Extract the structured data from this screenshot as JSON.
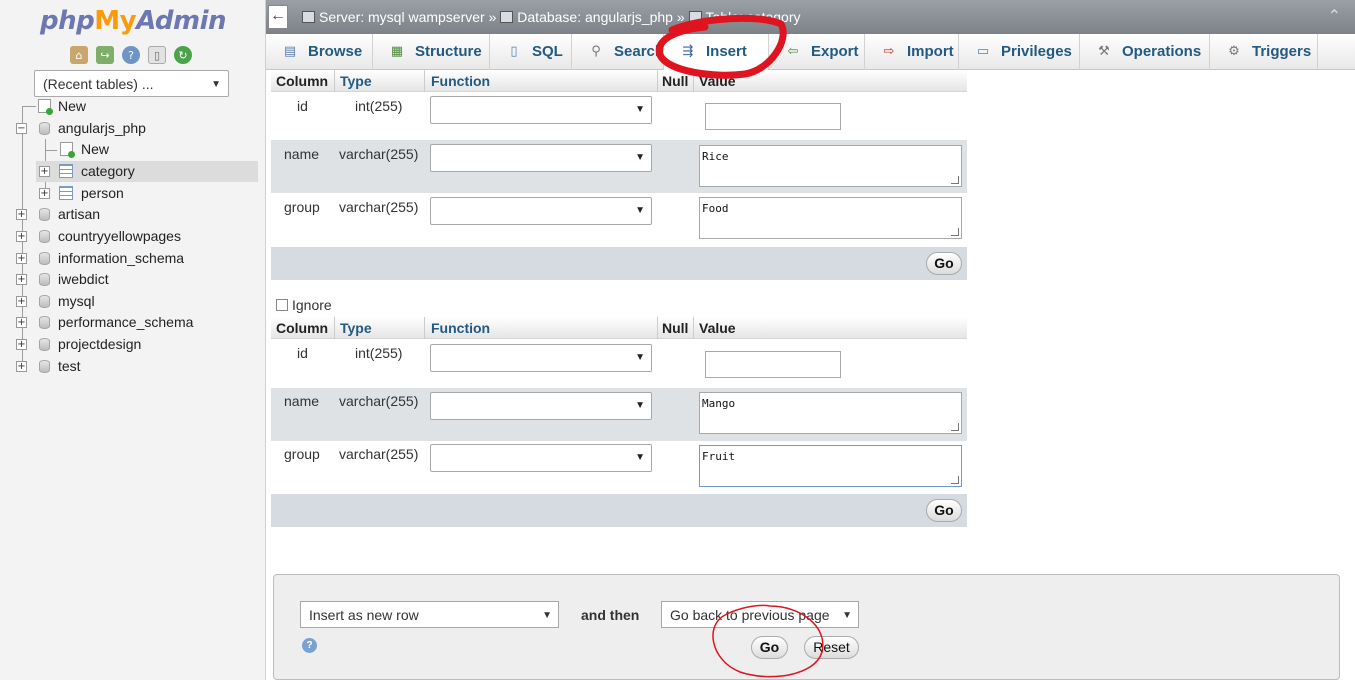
{
  "brand": {
    "php": "php",
    "my": "My",
    "admin": "Admin"
  },
  "nav": {
    "icons": [
      "home-icon",
      "logout-icon",
      "help-icon",
      "docs-icon",
      "reload-icon"
    ],
    "recent_tables": "(Recent tables) ...",
    "tree": [
      {
        "label": "New",
        "type": "new"
      },
      {
        "label": "angularjs_php",
        "type": "db-open"
      },
      {
        "label": "New",
        "type": "new-child"
      },
      {
        "label": "category",
        "type": "table",
        "selected": true
      },
      {
        "label": "person",
        "type": "table"
      },
      {
        "label": "artisan",
        "type": "db"
      },
      {
        "label": "countryyellowpages",
        "type": "db"
      },
      {
        "label": "information_schema",
        "type": "db"
      },
      {
        "label": "iwebdict",
        "type": "db"
      },
      {
        "label": "mysql",
        "type": "db"
      },
      {
        "label": "performance_schema",
        "type": "db"
      },
      {
        "label": "projectdesign",
        "type": "db"
      },
      {
        "label": "test",
        "type": "db"
      }
    ]
  },
  "breadcrumb": {
    "server": "Server: mysql wampserver",
    "sep1": " » ",
    "database": "Database: angularjs_php",
    "sep2": " » ",
    "table": "Table: category"
  },
  "tabs": [
    {
      "label": "Browse",
      "icon": "browse-icon"
    },
    {
      "label": "Structure",
      "icon": "structure-icon"
    },
    {
      "label": "SQL",
      "icon": "sql-icon"
    },
    {
      "label": "Search",
      "icon": "search-icon"
    },
    {
      "label": "Insert",
      "icon": "insert-icon",
      "active": true
    },
    {
      "label": "Export",
      "icon": "export-icon"
    },
    {
      "label": "Import",
      "icon": "import-icon"
    },
    {
      "label": "Privileges",
      "icon": "privileges-icon"
    },
    {
      "label": "Operations",
      "icon": "operations-icon"
    },
    {
      "label": "Triggers",
      "icon": "triggers-icon"
    }
  ],
  "headers": {
    "column": "Column",
    "type": "Type",
    "function": "Function",
    "null": "Null",
    "value": "Value"
  },
  "forms": [
    {
      "rows": [
        {
          "column": "id",
          "type": "int(255)",
          "value": ""
        },
        {
          "column": "name",
          "type": "varchar(255)",
          "value": "Rice"
        },
        {
          "column": "group",
          "type": "varchar(255)",
          "value": "Food"
        }
      ],
      "go_label": "Go"
    },
    {
      "rows": [
        {
          "column": "id",
          "type": "int(255)",
          "value": ""
        },
        {
          "column": "name",
          "type": "varchar(255)",
          "value": "Mango"
        },
        {
          "column": "group",
          "type": "varchar(255)",
          "value": "Fruit"
        }
      ],
      "go_label": "Go"
    }
  ],
  "ignore_label": "Ignore",
  "actions": {
    "insert_mode": "Insert as new row",
    "and_then": "and then",
    "after_insert": "Go back to previous page",
    "go_label": "Go",
    "reset_label": "Reset"
  },
  "colors": {
    "tab_text": "#235a81",
    "annotation": "#e0141e"
  }
}
